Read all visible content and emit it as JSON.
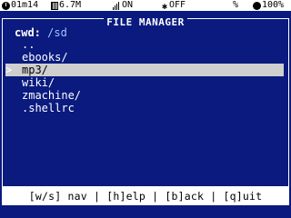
{
  "status_bar": {
    "uptime": "01m14",
    "memory": "6.7M",
    "signal": "ON",
    "bluetooth": "OFF",
    "wifi": "%",
    "battery": "100%"
  },
  "window": {
    "title": "FILE MANAGER"
  },
  "cwd": {
    "label": "cwd:",
    "path": "/sd"
  },
  "files": [
    {
      "name": "..",
      "selected": false
    },
    {
      "name": "ebooks/",
      "selected": false
    },
    {
      "name": "mp3/",
      "selected": true
    },
    {
      "name": "wiki/",
      "selected": false
    },
    {
      "name": "zmachine/",
      "selected": false
    },
    {
      "name": ".shellrc",
      "selected": false
    }
  ],
  "cursor_glyph": ">",
  "help_bar": {
    "text": "[w/s] nav | [h]elp | [b]ack | [q]uit"
  },
  "colors": {
    "background": "#0a1a7e",
    "selection": "#cfcfcf",
    "path": "#9fc4ff"
  }
}
